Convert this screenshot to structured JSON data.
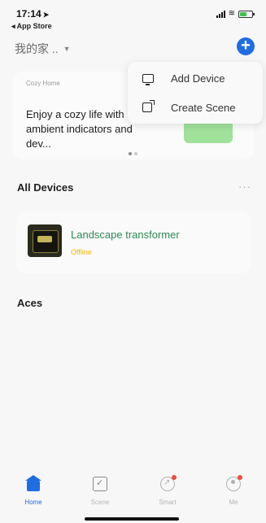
{
  "status": {
    "time": "17:14",
    "back_app": "◂ App Store"
  },
  "header": {
    "home_name": "我的家 ..",
    "add_symbol": "+"
  },
  "scene_card": {
    "tag": "Cozy Home",
    "text": "Enjoy a cozy life with ambient indicators and dev..."
  },
  "popup_menu": {
    "items": [
      {
        "label": "Add Device",
        "icon": "add-device-icon"
      },
      {
        "label": "Create Scene",
        "icon": "create-scene-icon"
      }
    ]
  },
  "devices_section": {
    "title": "All Devices",
    "more": "···",
    "devices": [
      {
        "name": "Landscape transformer",
        "status": "Offline"
      }
    ]
  },
  "aces_section": {
    "title": "Aces"
  },
  "tabbar": {
    "tabs": [
      {
        "label": "Home",
        "icon": "home-icon"
      },
      {
        "label": "Scene",
        "icon": "scene-icon"
      },
      {
        "label": "Smart",
        "icon": "smart-icon"
      },
      {
        "label": "Me",
        "icon": "me-icon"
      }
    ]
  },
  "colors": {
    "accent": "#1f6de3",
    "offline": "#f0b400",
    "badge": "#f24b3a"
  }
}
